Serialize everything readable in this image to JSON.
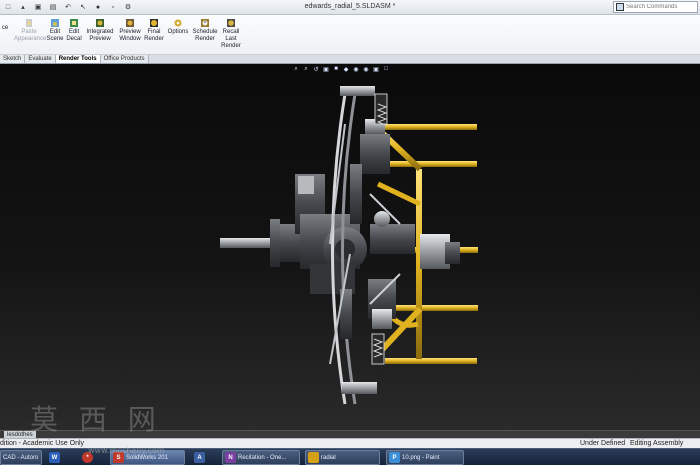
{
  "window": {
    "title": "edwards_radial_5.SLDASM *"
  },
  "search": {
    "placeholder": "Search Commands"
  },
  "ribbon": {
    "buttons": [
      {
        "id": "appearance",
        "l1": "Paste",
        "l2": "Appearance",
        "disabled": true
      },
      {
        "id": "edit-scene",
        "l1": "Edit",
        "l2": "Scene"
      },
      {
        "id": "edit-decal",
        "l1": "Edit",
        "l2": "Decal"
      },
      {
        "id": "integrated-preview",
        "l1": "Integrated",
        "l2": "Preview"
      },
      {
        "id": "preview-window",
        "l1": "Preview",
        "l2": "Window"
      },
      {
        "id": "final-render",
        "l1": "Final",
        "l2": "Render"
      },
      {
        "id": "options",
        "l1": "Options",
        "l2": ""
      },
      {
        "id": "schedule-render",
        "l1": "Schedule",
        "l2": "Render"
      },
      {
        "id": "recall-last-render",
        "l1": "Recall",
        "l2": "Last",
        "l3": "Render"
      }
    ],
    "cut_label": "ce"
  },
  "tabs": [
    "Sketch",
    "Evaluate",
    "Render Tools",
    "Office Products"
  ],
  "active_tab": "Render Tools",
  "model_tab": "lesdothes",
  "status": {
    "left": "dition - Academic Use Only",
    "under_defined": "Under Defined",
    "editing": "Editing Assembly"
  },
  "taskbar": [
    {
      "label": "CAD - Autoro",
      "color": "#3a6fb8",
      "glyph": "C"
    },
    {
      "label": "",
      "color": "#2b5fb8",
      "glyph": "W"
    },
    {
      "label": "",
      "color": "#c0392b",
      "glyph": "*"
    },
    {
      "label": "SolidWorks 201",
      "color": "#c0392b",
      "glyph": "S"
    },
    {
      "label": "",
      "color": "#3b5fa0",
      "glyph": "A"
    },
    {
      "label": "Recitation - One...",
      "color": "#7b3fa0",
      "glyph": "N"
    },
    {
      "label": "radial",
      "color": "#d4a017",
      "glyph": ""
    },
    {
      "label": "10.png - Paint",
      "color": "#3a8fd8",
      "glyph": "P"
    }
  ],
  "watermark": "莫 西 网",
  "watermark_url": "www.mosheny.com",
  "colors": {
    "frame": "#e0b21f",
    "metal": "#8a8d92",
    "dark_metal": "#3c3f44",
    "background": "#0a0a0a"
  }
}
